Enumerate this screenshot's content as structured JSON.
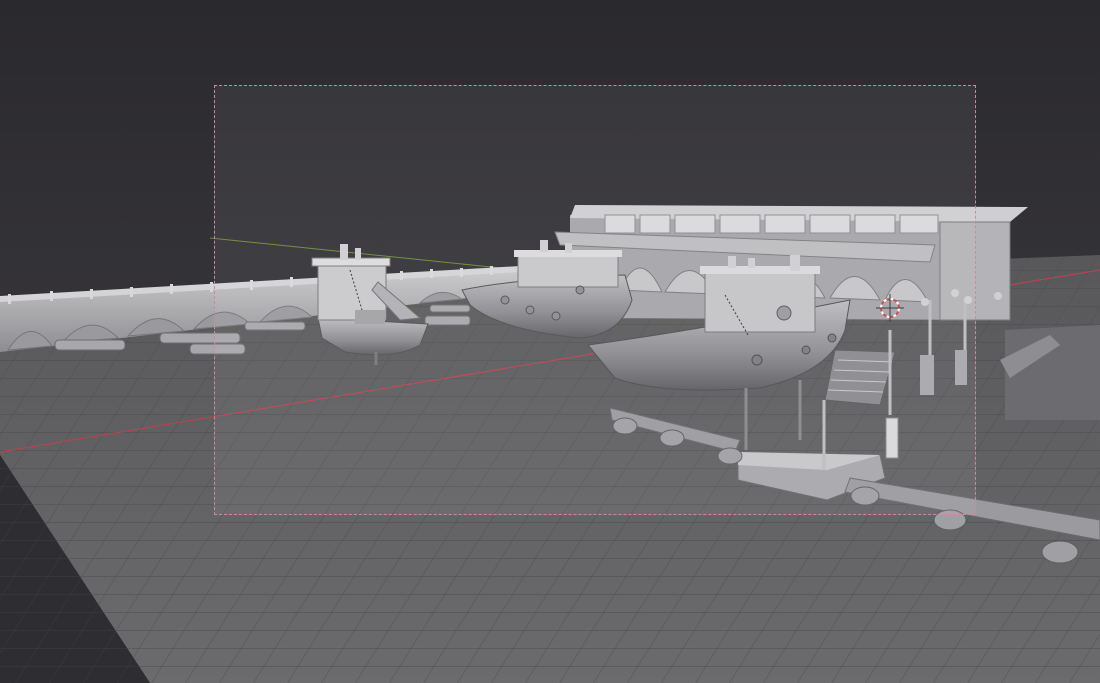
{
  "viewport": {
    "mode": "solid",
    "shading": "studio",
    "colors": {
      "background": "#2b2a2e",
      "floor": "#5b5b5d",
      "grid_line": "#4b4b4d",
      "x_axis": "#b24553",
      "y_axis": "#6f8a3a",
      "camera_border": "#c98a9a",
      "model_light": "#c7c7c9",
      "model_mid": "#9d9da1",
      "model_dark": "#5f5f63",
      "object_origin": "#d0424a"
    }
  },
  "scene": {
    "objects": [
      {
        "name": "pier-wall",
        "kind": "mesh"
      },
      {
        "name": "boat-small",
        "kind": "mesh"
      },
      {
        "name": "boat-middle",
        "kind": "mesh"
      },
      {
        "name": "boat-large",
        "kind": "mesh"
      },
      {
        "name": "warehouse",
        "kind": "mesh"
      },
      {
        "name": "stairs-dock",
        "kind": "mesh"
      },
      {
        "name": "slipway-rails",
        "kind": "mesh"
      },
      {
        "name": "lamp-posts",
        "kind": "mesh"
      },
      {
        "name": "3d-cursor",
        "kind": "helper"
      }
    ]
  }
}
